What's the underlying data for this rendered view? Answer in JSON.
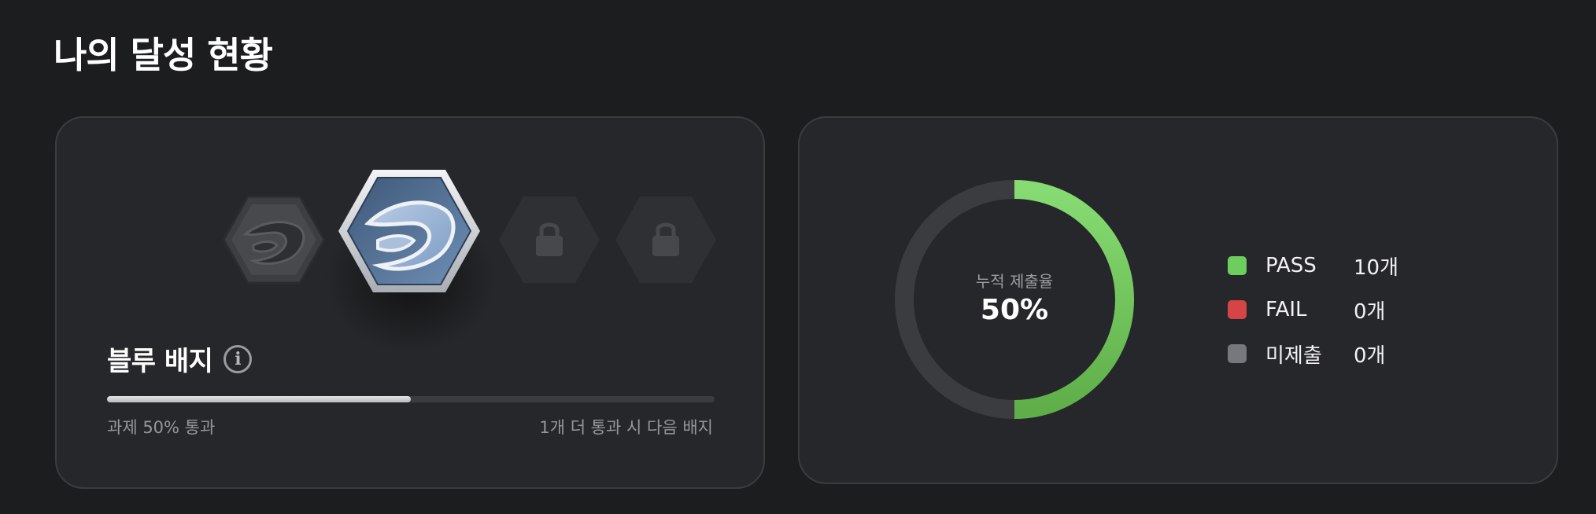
{
  "page": {
    "title": "나의 달성 현황"
  },
  "badge_card": {
    "badges": [
      {
        "name": "previous-badge",
        "state": "earned-dim",
        "icon": "wave-emblem-icon"
      },
      {
        "name": "blue-badge",
        "state": "current",
        "icon": "wave-emblem-icon"
      },
      {
        "name": "locked-badge",
        "state": "locked",
        "icon": "lock-icon"
      },
      {
        "name": "locked-badge",
        "state": "locked",
        "icon": "lock-icon"
      }
    ],
    "current_badge_name": "블루 배지",
    "info_icon": "i",
    "progress_fraction": 0.5,
    "progress_left_text": "과제 50% 통과",
    "progress_right_text": "1개 더 통과 시 다음 배지"
  },
  "stats_card": {
    "donut_label": "누적 제출율",
    "donut_value": "50%",
    "donut_fraction": 0.5,
    "colors": {
      "pass": "#6ccf5d",
      "fail": "#d64545",
      "unsubmitted": "#76787d",
      "track": "#3a3c40"
    },
    "legend": [
      {
        "label": "PASS",
        "count": "10개",
        "color": "#6ccf5d"
      },
      {
        "label": "FAIL",
        "count": "0개",
        "color": "#d64545"
      },
      {
        "label": "미제출",
        "count": "0개",
        "color": "#76787d"
      }
    ]
  }
}
